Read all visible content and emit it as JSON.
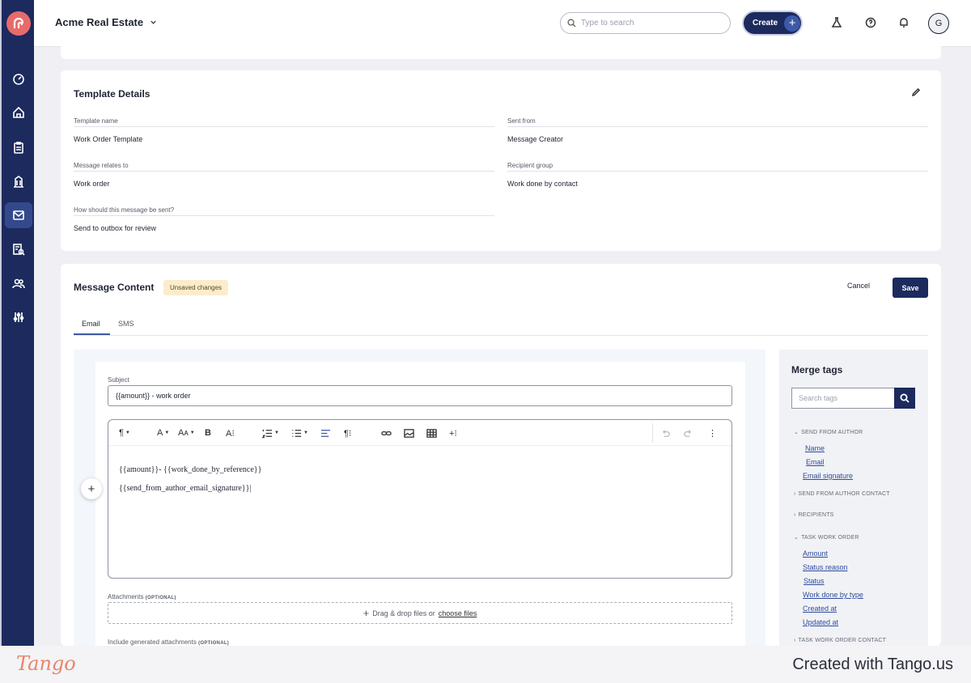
{
  "colors": {
    "sidebar": "#1c2a5e",
    "accent": "#3c5aa8",
    "logo": "#e86b6b",
    "badge_bg": "#fbeccb"
  },
  "header": {
    "org_name": "Acme Real Estate",
    "search_placeholder": "Type to search",
    "create_label": "Create",
    "avatar_initial": "G",
    "icons": [
      "flask-icon",
      "help-icon",
      "bell-icon"
    ]
  },
  "sidebar": {
    "items": [
      {
        "name": "dashboard-icon"
      },
      {
        "name": "home-icon"
      },
      {
        "name": "clipboard-icon"
      },
      {
        "name": "building-icon"
      },
      {
        "name": "mail-icon",
        "active": true
      },
      {
        "name": "search-document-icon"
      },
      {
        "name": "people-icon"
      },
      {
        "name": "sliders-icon"
      }
    ]
  },
  "template_details": {
    "title": "Template Details",
    "fields": {
      "template_name": {
        "label": "Template name",
        "value": "Work Order Template"
      },
      "sent_from": {
        "label": "Sent from",
        "value": "Message Creator"
      },
      "relates_to": {
        "label": "Message relates to",
        "value": "Work order"
      },
      "recipient_group": {
        "label": "Recipient group",
        "value": "Work done by contact"
      },
      "send_method": {
        "label": "How should this message be sent?",
        "value": "Send to outbox for review"
      }
    }
  },
  "message_content": {
    "title": "Message Content",
    "badge": "Unsaved changes",
    "cancel_label": "Cancel",
    "save_label": "Save",
    "tabs": [
      "Email",
      "SMS"
    ],
    "subject_label": "Subject",
    "subject_value": "{{amount}} - work order",
    "body_lines": [
      "{{amount}}- {{work_done_by_reference}}",
      "{{send_from_author_email_signature}}|"
    ],
    "attachments_label": "Attachments",
    "optional": "(OPTIONAL)",
    "dropzone_text": "Drag & drop files or",
    "dropzone_link": "choose files",
    "generated_label": "Include generated attachments"
  },
  "merge_tags": {
    "title": "Merge tags",
    "search_placeholder": "Search tags",
    "groups": [
      {
        "label": "SEND FROM AUTHOR",
        "expanded": true,
        "tags": [
          "Name",
          "Email",
          "Email signature"
        ]
      },
      {
        "label": "SEND FROM AUTHOR CONTACT",
        "expanded": false
      },
      {
        "label": "RECIPIENTS",
        "expanded": false
      },
      {
        "label": "TASK WORK ORDER",
        "expanded": true,
        "tags": [
          "Amount",
          "Status reason",
          "Status",
          "Work done by type",
          "Created at",
          "Updated at"
        ]
      },
      {
        "label": "TASK WORK ORDER CONTACT",
        "expanded": false
      }
    ]
  },
  "footer": {
    "brand": "Tango",
    "credit": "Created with Tango.us"
  }
}
